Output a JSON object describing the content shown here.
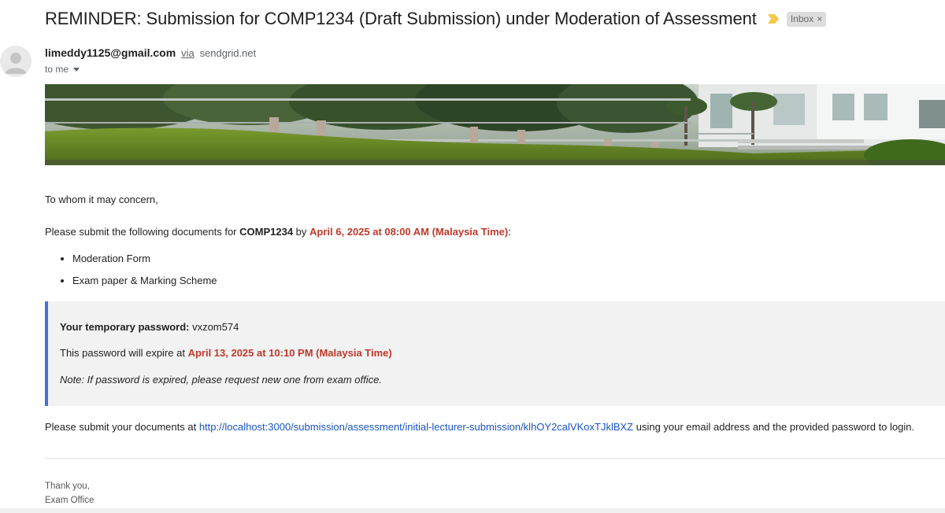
{
  "email": {
    "subject": "REMINDER: Submission for COMP1234 (Draft Submission) under Moderation of Assessment",
    "label_chip": "Inbox",
    "label_chip_close": "×",
    "sender": {
      "email": "limeddy1125@gmail.com",
      "via": "via",
      "via_domain": "sendgrid.net",
      "to": "to me"
    }
  },
  "body": {
    "greeting": "To whom it may concern,",
    "request": {
      "prefix": "Please submit the following documents for ",
      "course": "COMP1234",
      "by": " by ",
      "deadline": "April 6, 2025 at 08:00 AM (Malaysia Time)",
      "suffix": ":"
    },
    "documents": [
      "Moderation Form",
      "Exam paper & Marking Scheme"
    ],
    "password_box": {
      "label": "Your temporary password:",
      "password": " vxzom574",
      "expire_prefix": "This password will expire at ",
      "expire_time": "April 13, 2025 at 10:10 PM (Malaysia Time)",
      "note": "Note: If password is expired, please request new one from exam office."
    },
    "submit": {
      "prefix": "Please submit your documents at ",
      "url": "http://localhost:3000/submission/assessment/initial-lecturer-submission/klhOY2calVKoxTJklBXZ",
      "suffix": " using your email address and the provided password to login."
    },
    "signoff": {
      "thanks": "Thank you,",
      "from": "Exam Office"
    }
  },
  "colors": {
    "accent_red": "#c0392b",
    "link_blue": "#1a55c4",
    "box_border": "#4a6fd6",
    "importance_marker": "#f2c94c"
  }
}
